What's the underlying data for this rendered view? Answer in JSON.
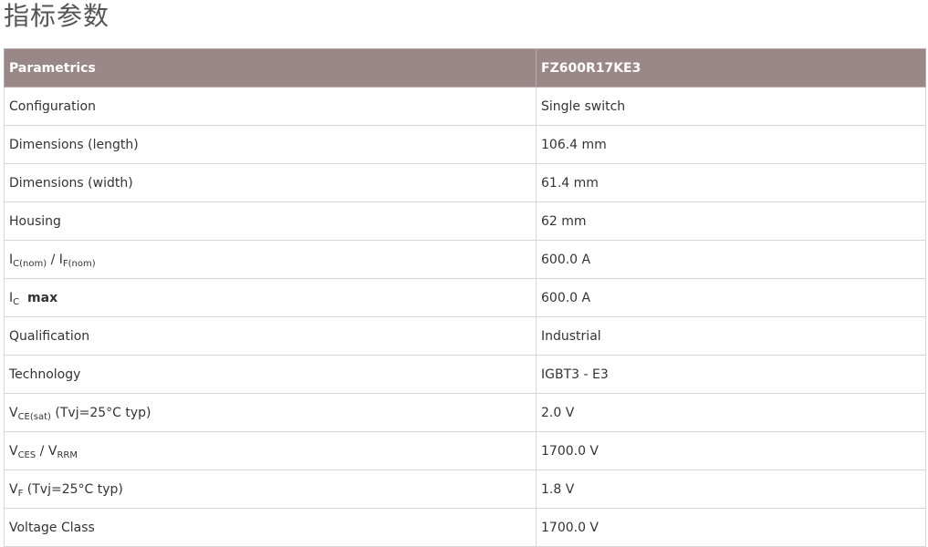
{
  "page": {
    "title": "指标参数"
  },
  "table": {
    "headers": [
      "Parametrics",
      "FZ600R17KE3"
    ],
    "rows": [
      {
        "label": "Configuration",
        "value": "Single switch"
      },
      {
        "label": "Dimensions (length)",
        "value": "106.4 mm"
      },
      {
        "label": "Dimensions (width)",
        "value": "61.4 mm"
      },
      {
        "label": "Housing",
        "value": "62 mm"
      },
      {
        "label_parts": {
          "p1": "I",
          "s1": "C(nom)",
          "p2": " / I",
          "s2": "F(nom)"
        },
        "value": "600.0 A"
      },
      {
        "label_parts": {
          "p1": "I",
          "s1": "C",
          "p2": "max"
        },
        "value": "600.0 A"
      },
      {
        "label": "Qualification",
        "value": "Industrial"
      },
      {
        "label": "Technology",
        "value": "IGBT3 - E3"
      },
      {
        "label_parts": {
          "p1": "V",
          "s1": "CE(sat)",
          "p2": " (Tvj=25°C typ)"
        },
        "value": "2.0 V"
      },
      {
        "label_parts": {
          "p1": "V",
          "s1": "CES",
          "p2": " / V",
          "s2": "RRM"
        },
        "value": "1700.0 V"
      },
      {
        "label_parts": {
          "p1": "V",
          "s1": "F",
          "p2": " (Tvj=25°C typ)"
        },
        "value": "1.8 V"
      },
      {
        "label": "Voltage Class",
        "value": "1700.0 V"
      }
    ]
  }
}
